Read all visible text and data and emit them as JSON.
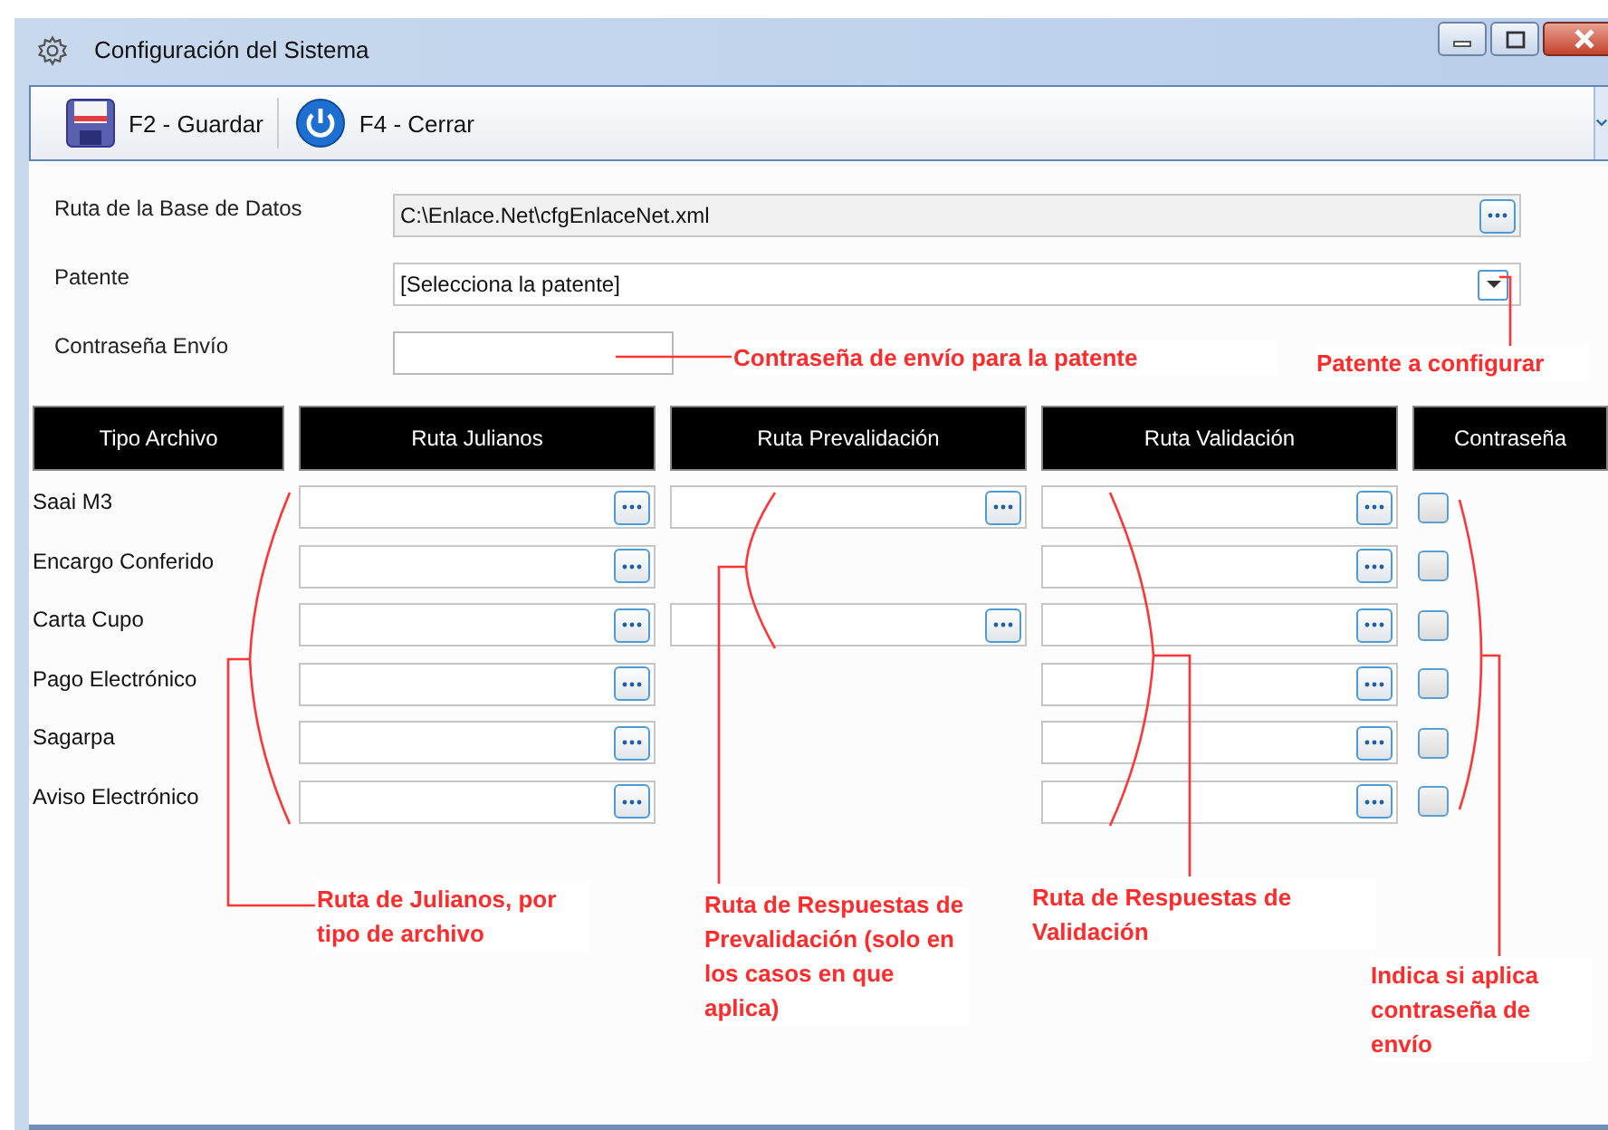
{
  "window": {
    "title": "Configuración del Sistema"
  },
  "toolbar": {
    "buttons": [
      {
        "kind": "save",
        "label": "F2 - Guardar"
      },
      {
        "kind": "power",
        "label": "F4 - Cerrar"
      }
    ]
  },
  "form": {
    "database_path": {
      "label": "Ruta de la Base de Datos",
      "value": "C:\\Enlace.Net\\cfgEnlaceNet.xml"
    },
    "patent": {
      "label": "Patente",
      "value": "[Selecciona la patente]"
    },
    "password": {
      "label": "Contraseña Envío"
    }
  },
  "table": {
    "columns": [
      "Tipo Archivo",
      "Ruta Julianos",
      "Ruta Prevalidación",
      "Ruta Validación",
      "Contraseña"
    ],
    "rows": [
      {
        "type": "Saai M3",
        "prevalidation": true,
        "checked": false
      },
      {
        "type": "Encargo Conferido",
        "prevalidation": false,
        "checked": false
      },
      {
        "type": "Carta Cupo",
        "prevalidation": true,
        "checked": false
      },
      {
        "type": "Pago Electrónico",
        "prevalidation": false,
        "checked": false
      },
      {
        "type": "Sagarpa",
        "prevalidation": false,
        "checked": false
      },
      {
        "type": "Aviso Electrónico",
        "prevalidation": false,
        "checked": false
      }
    ]
  },
  "annotations": [
    "Contraseña de envío para la patente",
    "Patente a configurar",
    "Ruta de Julianos, por tipo de archivo",
    "Ruta de Respuestas de Prevalidación (solo en los casos en que aplica)",
    "Ruta de Respuestas de Validación",
    "Indica si aplica contraseña de envío"
  ]
}
